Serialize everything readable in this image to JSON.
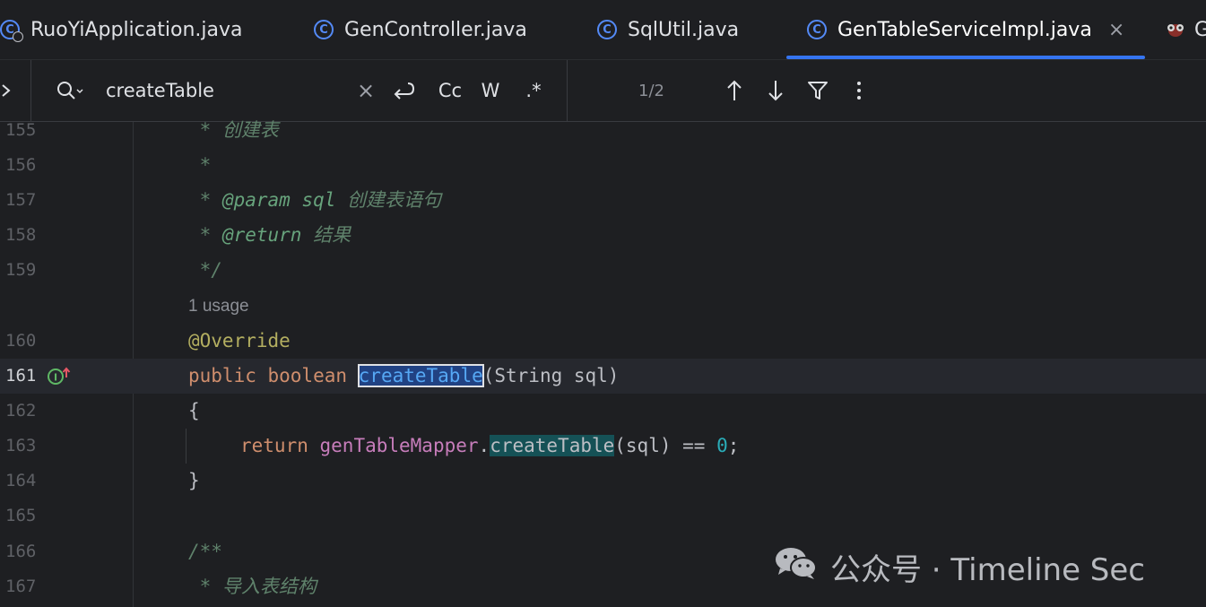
{
  "tabs": [
    {
      "label": "RuoYiApplication.java",
      "icon": "java-run-class-icon",
      "active": false
    },
    {
      "label": "GenController.java",
      "icon": "java-class-icon",
      "active": false
    },
    {
      "label": "SqlUtil.java",
      "icon": "java-class-icon",
      "active": false
    },
    {
      "label": "GenTableServiceImpl.java",
      "icon": "java-class-icon",
      "active": true
    },
    {
      "label": "G",
      "icon": "bug-icon",
      "active": false
    }
  ],
  "tab_close_symbol": "×",
  "search": {
    "query": "createTable",
    "clear_symbol": "×",
    "match_case_label": "Cc",
    "words_label": "W",
    "regex_label": ".*",
    "match_count": "1/2"
  },
  "editor": {
    "lines": [
      {
        "num": "155",
        "text": " * 创建表"
      },
      {
        "num": "156",
        "text": " *"
      },
      {
        "num": "157",
        "text": " * @param sql 创建表语句"
      },
      {
        "num": "158",
        "text": " * @return 结果"
      },
      {
        "num": "159",
        "text": " */"
      },
      {
        "num": "160",
        "text": "@Override"
      },
      {
        "num": "161",
        "text": "public boolean createTable(String sql)"
      },
      {
        "num": "162",
        "text": "{"
      },
      {
        "num": "163",
        "text": "    return genTableMapper.createTable(sql) == 0;"
      },
      {
        "num": "164",
        "text": "}"
      },
      {
        "num": "165",
        "text": ""
      },
      {
        "num": "166",
        "text": "/**"
      },
      {
        "num": "167",
        "text": " * 导入表结构"
      }
    ],
    "usage_hint": "1 usage",
    "tokens": {
      "l155_star": " * ",
      "l155_doc": "创建表",
      "l157_star": " * ",
      "l157_tag": "@param",
      "l157_name": " sql ",
      "l157_doc": "创建表语句",
      "l158_star": " * ",
      "l158_tag": "@return",
      "l158_doc": " 结果",
      "l161_kw": "public boolean ",
      "l161_fn": "createTable",
      "l161_rest": "(String sql)",
      "l163_kw": "return ",
      "l163_field": "genTableMapper",
      "l163_dot": ".",
      "l163_fn": "createTable",
      "l163_rest": "(sql) == ",
      "l163_num": "0",
      "l163_end": ";"
    }
  },
  "watermark": {
    "text": "公众号 · Timeline Sec",
    "icon": "wechat-icon"
  },
  "colors": {
    "background": "#1e1f22",
    "accent": "#3574f0",
    "keyword": "#cf8e6d",
    "annotation": "#b3ae60",
    "doc_comment": "#5f826b",
    "field": "#c77dbb",
    "number": "#2aacb8"
  }
}
